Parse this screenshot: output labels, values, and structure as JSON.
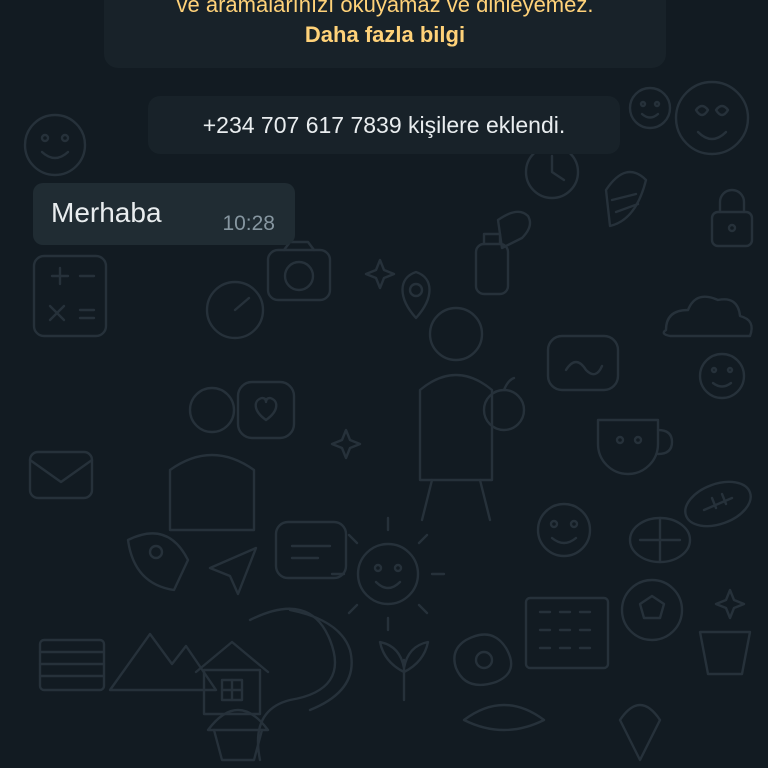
{
  "encryption_notice": {
    "text": "ve aramalarınızı okuyamaz ve dinleyemez.",
    "link": "Daha fazla bilgi"
  },
  "system_message": {
    "text": "+234 707 617 7839 kişilere eklendi."
  },
  "messages": [
    {
      "text": "Merhaba",
      "time": "10:28",
      "direction": "incoming"
    }
  ],
  "colors": {
    "background": "#121b22",
    "bubble_incoming": "#202c33",
    "system_bubble": "#182229",
    "notice_text": "#ffd279",
    "text_primary": "#e9edef",
    "text_secondary": "#8696a0"
  },
  "background_icons": [
    "smiley-icon",
    "heart-eyes-icon",
    "sun-icon",
    "house-icon",
    "camera-icon",
    "map-pin-icon",
    "sparkle-icon",
    "rocket-icon",
    "calculator-icon",
    "coffee-cup-icon",
    "building-icon",
    "soccer-ball-icon",
    "football-icon",
    "clock-icon",
    "corn-icon",
    "lock-icon",
    "plant-icon",
    "paper-plane-icon",
    "cupcake-icon",
    "fried-egg-icon"
  ]
}
